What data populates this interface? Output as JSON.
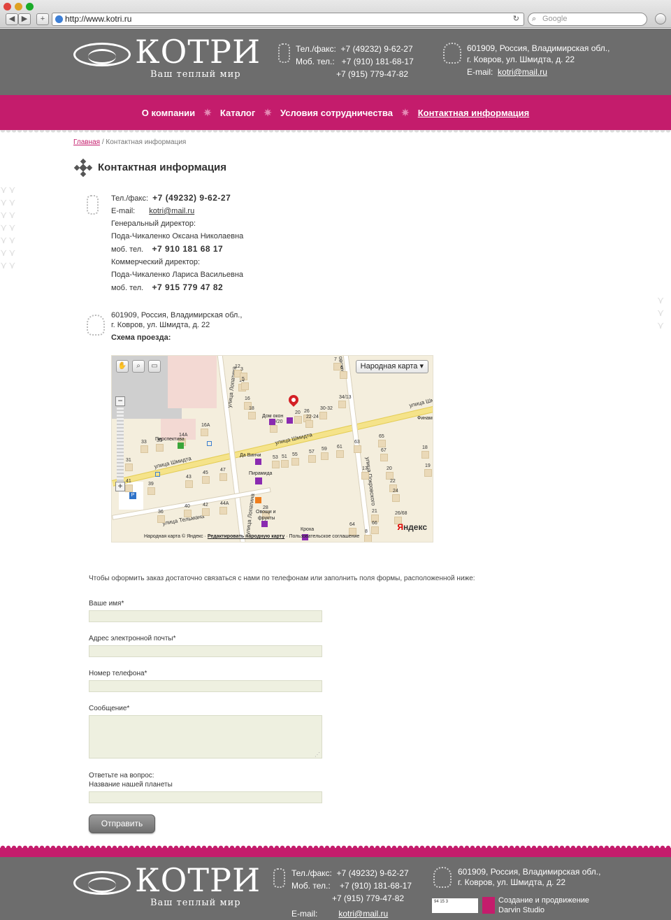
{
  "browser": {
    "url": "http://www.kotri.ru",
    "search_placeholder": "Google",
    "back": "◀",
    "forward": "▶",
    "add": "+",
    "reload": "↻"
  },
  "header": {
    "logo_name": "КОТРИ",
    "slogan": "Ваш теплый мир",
    "phone_label": "Тел./факс:",
    "phone": "+7 (49232) 9-62-27",
    "mobile_label": "Моб. тел.:",
    "mobile1": "+7 (910) 181-68-17",
    "mobile2": "+7 (915) 779-47-82",
    "address1": "601909, Россия, Владимирская обл.,",
    "address2": "г. Ковров, ул. Шмидта, д. 22",
    "email_label": "E-mail:",
    "email": "kotri@mail.ru"
  },
  "menu": {
    "items": [
      "О компании",
      "Каталог",
      "Условия сотрудничества",
      "Контактная информация"
    ],
    "separator": "✷"
  },
  "breadcrumb": {
    "home": "Главная",
    "sep": " / ",
    "current": "Контактная информация"
  },
  "page_title": "Контактная информация",
  "contacts": {
    "phone_label": "Тел./факс:",
    "phone": "+7 (49232) 9-62-27",
    "email_label": "E-mail:",
    "email": "kotri@mail.ru",
    "gd_title": "Генеральный директор:",
    "gd_name": "Пода-Чикаленко Оксана Николаевна",
    "mob_label": "моб. тел.",
    "gd_phone": "+7 910 181 68 17",
    "cd_title": "Коммерческий директор:",
    "cd_name": "Пода-Чикаленко Лариса Васильевна",
    "cd_phone": "+7 915 779 47 82",
    "address1": "601909, Россия, Владимирская обл.,",
    "address2": "г. Ковров, ул. Шмидта, д. 22",
    "route_label": "Схема проезда:"
  },
  "map": {
    "dropdown": "Народная карта ▾",
    "zoom_in": "+",
    "zoom_out": "−",
    "streets": {
      "schmidt1": "улица Шмидта",
      "schmidt2": "улица Шмидта",
      "schmidt3": "улица Шми",
      "lopatina1": "улица Лопатина",
      "lopatina2": "улица Лопатина",
      "pokrovskogo": "улица Покровского",
      "telmana": "улица Тельмана",
      "pokr_top": "овского"
    },
    "poi": {
      "dom_okon": "Дом окон",
      "perspektiva": "Перспектива",
      "da_vinchi": "Да Винчи",
      "piramida": "Пирамида",
      "ovoschi": "Овощи и",
      "frukty": "фрукты",
      "kroha": "Кроха",
      "finam": "Финам"
    },
    "numbers": [
      "7",
      "6",
      "12",
      "14",
      "16",
      "18",
      "20",
      "26",
      "30-32",
      "34/13",
      "14А",
      "16А",
      "33",
      "35",
      "31",
      "53",
      "51",
      "55",
      "57",
      "59",
      "61",
      "63",
      "65",
      "67",
      "18",
      "19",
      "39",
      "43",
      "45",
      "47",
      "41",
      "40",
      "42",
      "44А",
      "36",
      "17",
      "20",
      "22",
      "24",
      "21",
      "26/68",
      "64",
      "66",
      "28",
      "8",
      "22-24",
      "19/20",
      "3",
      "5"
    ],
    "copyright": "Народная карта © Яндекс · ",
    "edit_link": "Редактировать народную карту",
    "agreement": " · Пользовательское соглашение",
    "yandex": "Яндекс"
  },
  "form": {
    "intro": "Чтобы оформить заказ достаточно связаться с нами по телефонам или заполнить поля формы, расположенной ниже:",
    "name_label": "Ваше имя*",
    "email_label": "Адрес электронной почты*",
    "phone_label": "Номер телефона*",
    "message_label": "Сообщение*",
    "question_label": "Ответьте на вопрос:",
    "question": "Название нашей планеты",
    "submit": "Отправить"
  },
  "footer": {
    "logo_name": "КОТРИ",
    "slogan": "Ваш теплый мир",
    "phone_label": "Тел./факс:",
    "phone": "+7 (49232) 9-62-27",
    "mobile_label": "Моб. тел.:",
    "mobile1": "+7 (910) 181-68-17",
    "mobile2": "+7 (915) 779-47-82",
    "email_label": "E-mail:",
    "email": "kotri@mail.ru",
    "address1": "601909, Россия, Владимирская обл.,",
    "address2": "г. Ковров, ул. Шмидта, д. 22",
    "counter": "94 15 3",
    "studio_link": "Создание и продвижение",
    "studio_name": "Darvin Studio"
  },
  "colors": {
    "brand_pink": "#c41c6c",
    "header_gray": "#6d6d6d",
    "field_bg": "#eef0e0"
  }
}
